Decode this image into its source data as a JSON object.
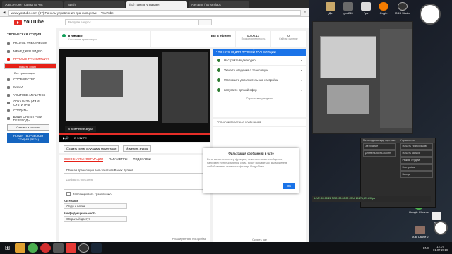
{
  "browser": {
    "tabs": [
      "Жак Энтони - Калиф на час",
      "Twitch",
      "(87) Панель управлен",
      "Alert Box / Streamlabs"
    ],
    "url": "www.youtube.com",
    "page_title": "(87) Панель управления трансляциями – YouTube"
  },
  "yt": {
    "logo": "YouTube",
    "search_placeholder": "Введите запрос"
  },
  "sidebar": {
    "title": "ТВОРЧЕСКАЯ СТУДИЯ",
    "items": [
      "ПАНЕЛЬ УПРАВЛЕНИЯ",
      "МЕНЕДЖЕР ВИДЕО",
      "ПРЯМЫЕ ТРАНСЛЯЦИИ"
    ],
    "subs": [
      "Начать эфир",
      "Все трансляции"
    ],
    "items2": [
      "СООБЩЕСТВО",
      "КАНАЛ",
      "YOUTUBE ANALYTICS",
      "ЛОКАЛИЗАЦИЯ И СУБТИТРЫ",
      "СОЗДАТЬ",
      "ВАШИ СУБТИТРЫ И ПЕРЕВОДЫ"
    ],
    "feedback": "Отзывы и отклики",
    "new_studio": "НОВАЯ ТВОРЧЕСКАЯ СТУДИЯ (БЕТА)"
  },
  "status": {
    "live": "В ЭФИРЕ",
    "live_sub": "Состояние трансляции",
    "msg": "Вы в эфире!",
    "timer": "00:00:11",
    "timer_sub": "Продолжительность",
    "viewers": "0",
    "viewers_sub": "Сейчас смотрят"
  },
  "player": {
    "tooltip": "Отключение звука",
    "live_label": "В ЭФИРЕ"
  },
  "cards": [
    "Создать ролик с лучшими моментами",
    "Изменить значок"
  ],
  "info": {
    "tabs": [
      "ОСНОВНАЯ ИНФОРМАЦИЯ",
      "ПАРАМЕТРЫ",
      "ПОДСКАЗКИ"
    ],
    "title_value": "Прямая трансляция пользователя Валех Кулиев",
    "desc_placeholder": "Добавить описание",
    "scheduled": "Запланировать трансляцию",
    "category_label": "Категория",
    "category_value": "Люди и блоги",
    "privacy_label": "Конфиденциальность",
    "privacy_value": "Открытый доступ",
    "advanced": "Расширенные настройки"
  },
  "steps": {
    "header": "ЧТО НУЖНО ДЛЯ ПРЯМОЙ ТРАНСЛЯЦИИ",
    "items": [
      "Настройте видеокодер",
      "Укажите сведения о трансляции",
      "Установите дополнительные настройки",
      "Запустите прямой эфир"
    ],
    "hide": "Скрыть эти разделы"
  },
  "chat": {
    "header": "Только интересные сообщения",
    "footer": "Скрыть чат"
  },
  "modal": {
    "title": "Фильтрация сообщений в чате",
    "body": "Если вы включите эту функцию, нежелательные сообщения, например потенциальный спам, будут скрываться. Вы можете в любой момент отключить фильтр. Подробнее",
    "ok": "OK"
  },
  "obs": {
    "panel1": "Переходы между сценами",
    "panel2": "Управление",
    "buttons": [
      "Начать трансляцию",
      "Начать запись",
      "Режим студии",
      "Настройки",
      "Выход"
    ],
    "fade": "Затухание",
    "duration": "Длительность 300ms",
    "status": "LIVE: 00:00:28   REC: 00:00:00   CPU: 21.2%, 29.89 fps"
  },
  "desktop": {
    "icons": [
      "Дз",
      "gon243",
      "Гра",
      "Origin",
      "OBS Studio",
      "Google Chrome",
      "Nes",
      "Just Cause 2"
    ]
  },
  "taskbar": {
    "lang": "ENG",
    "time": "12:07",
    "date": "01.07.2018"
  }
}
